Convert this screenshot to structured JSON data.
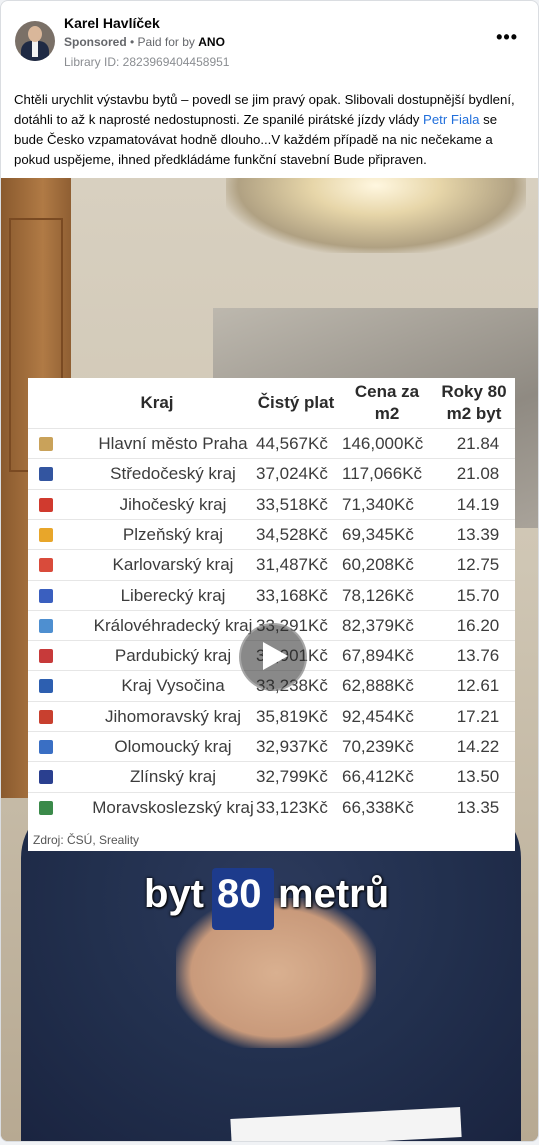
{
  "post": {
    "author": "Karel Havlíček",
    "sponsored": "Sponsored",
    "paid_for": " • Paid for by ",
    "funder": "ANO",
    "library_id": "Library ID: 2823969404458951",
    "text_before": "Chtěli urychlit výstavbu bytů – povedl se jim pravý opak. Slibovali dostupnější bydlení, dotáhli to až k naprosté nedostupnosti. Ze spanilé pirátské jízdy vlády ",
    "text_link": "Petr Fiala",
    "text_after": " se bude Česko vzpamatovávat hodně dlouho...V každém případě na nic nečekame a pokud uspějeme, ihned předkládáme funkční stavební Bude připraven."
  },
  "table": {
    "headers": {
      "kraj": "Kraj",
      "plat": "Čistý plat",
      "cena": "Cena za m2",
      "roky": "Roky 80 m2 byt"
    },
    "rows": [
      {
        "kraj": "Hlavní město Praha",
        "plat": "44,567Kč",
        "cena": "146,000Kč",
        "roky": "21.84",
        "color": "#c9a25a"
      },
      {
        "kraj": "Středočeský kraj",
        "plat": "37,024Kč",
        "cena": "117,066Kč",
        "roky": "21.08",
        "color": "#3355a0"
      },
      {
        "kraj": "Jihočeský kraj",
        "plat": "33,518Kč",
        "cena": "71,340Kč",
        "roky": "14.19",
        "color": "#d03a2e"
      },
      {
        "kraj": "Plzeňský kraj",
        "plat": "34,528Kč",
        "cena": "69,345Kč",
        "roky": "13.39",
        "color": "#e8a62a"
      },
      {
        "kraj": "Karlovarský kraj",
        "plat": "31,487Kč",
        "cena": "60,208Kč",
        "roky": "12.75",
        "color": "#d94b3b"
      },
      {
        "kraj": "Liberecký kraj",
        "plat": "33,168Kč",
        "cena": "78,126Kč",
        "roky": "15.70",
        "color": "#3a5fbf"
      },
      {
        "kraj": "Královéhradecký kraj",
        "plat": "33,291Kč",
        "cena": "82,379Kč",
        "roky": "16.20",
        "color": "#4e8fd0"
      },
      {
        "kraj": "Pardubický kraj",
        "plat": "32,901Kč",
        "cena": "67,894Kč",
        "roky": "13.76",
        "color": "#c73a3a"
      },
      {
        "kraj": "Kraj Vysočina",
        "plat": "33,238Kč",
        "cena": "62,888Kč",
        "roky": "12.61",
        "color": "#2d5fb0"
      },
      {
        "kraj": "Jihomoravský kraj",
        "plat": "35,819Kč",
        "cena": "92,454Kč",
        "roky": "17.21",
        "color": "#c8402f"
      },
      {
        "kraj": "Olomoucký kraj",
        "plat": "32,937Kč",
        "cena": "70,239Kč",
        "roky": "14.22",
        "color": "#3a6fc4"
      },
      {
        "kraj": "Zlínský kraj",
        "plat": "32,799Kč",
        "cena": "66,412Kč",
        "roky": "13.50",
        "color": "#2a3f8f"
      },
      {
        "kraj": "Moravskoslezský kraj",
        "plat": "33,123Kč",
        "cena": "66,338Kč",
        "roky": "13.35",
        "color": "#3b8a4a"
      }
    ],
    "source": "Zdroj: ČSÚ, Sreality"
  },
  "caption": {
    "part1": "byt",
    "highlight": "80",
    "part2": "metrů"
  },
  "icons": {
    "more": "more-options-icon",
    "play": "play-icon"
  }
}
